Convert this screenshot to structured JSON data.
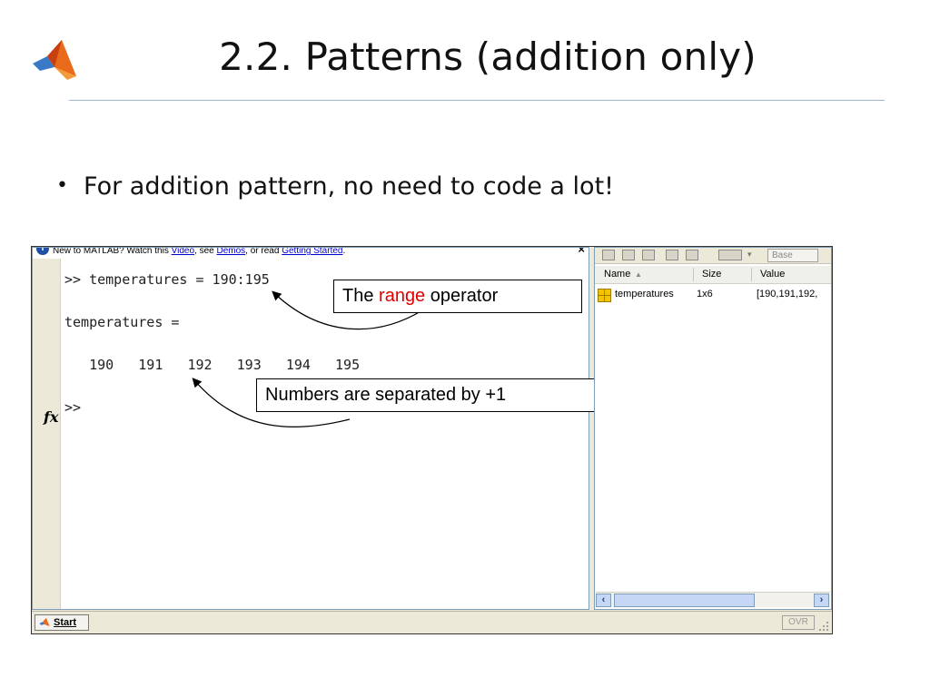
{
  "slide": {
    "title": "2.2. Patterns (addition only)",
    "bullet": "For addition pattern, no need to code a lot!",
    "logo_icon": "matlab-logo-icon"
  },
  "infobar": {
    "prefix": "New to MATLAB? Watch this ",
    "link_video": "Video",
    "mid1": ", see ",
    "link_demos": "Demos",
    "mid2": ", or read ",
    "link_getting_started": "Getting Started",
    "suffix": ".",
    "close": "×"
  },
  "command_window": {
    "line1": ">> temperatures = 190:195",
    "line2": "temperatures =",
    "line3": "   190   191   192   193   194   195",
    "prompt": ">>",
    "fx_label": "fx"
  },
  "callouts": {
    "range_pre": "The ",
    "range_word": "range",
    "range_post": " operator",
    "separated": "Numbers are separated by +1",
    "accent_color": "#e00000"
  },
  "workspace": {
    "base_label": "Base",
    "columns": [
      "Name",
      "Size",
      "Value"
    ],
    "rows": [
      {
        "name": "temperatures",
        "size": "1x6",
        "value": "[190,191,192,"
      }
    ]
  },
  "statusbar": {
    "start_label": "Start",
    "ovr_label": "OVR"
  }
}
